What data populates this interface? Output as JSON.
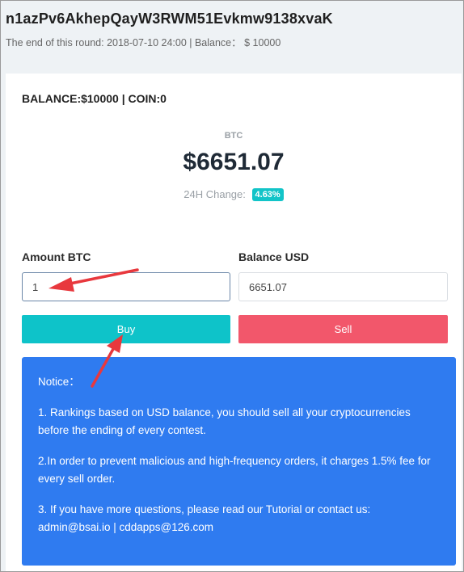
{
  "header": {
    "room_id": "n1azPv6AkhepQayW3RWM51Evkmw9138xvaK",
    "round_info": "The end of this round: 2018-07-10 24:00 | Balance： $ 10000"
  },
  "wallet": {
    "summary": "BALANCE:$10000 | COIN:0"
  },
  "ticker": {
    "symbol": "BTC",
    "price": "$6651.07",
    "change_label": "24H Change:",
    "change_value": "4.63%",
    "change_color": "#12c4c8"
  },
  "trade_form": {
    "amount_label": "Amount BTC",
    "amount_value": "1",
    "balance_label": "Balance USD",
    "balance_value": "6651.07",
    "buy_label": "Buy",
    "sell_label": "Sell",
    "buy_color": "#0ec3c9",
    "sell_color": "#f2576b"
  },
  "notice": {
    "title": "Notice：",
    "items": [
      "1. Rankings based on USD balance, you should sell all your cryptocurrencies before the ending of every contest.",
      "2.In order to prevent malicious and high-frequency orders, it charges 1.5% fee for every sell order.",
      "3. If you have more questions, please read our Tutorial or contact us: admin@bsai.io | cddapps@126.com"
    ],
    "background_color": "#2f7bf0"
  },
  "annotation": {
    "arrow_color": "#e8383d"
  }
}
